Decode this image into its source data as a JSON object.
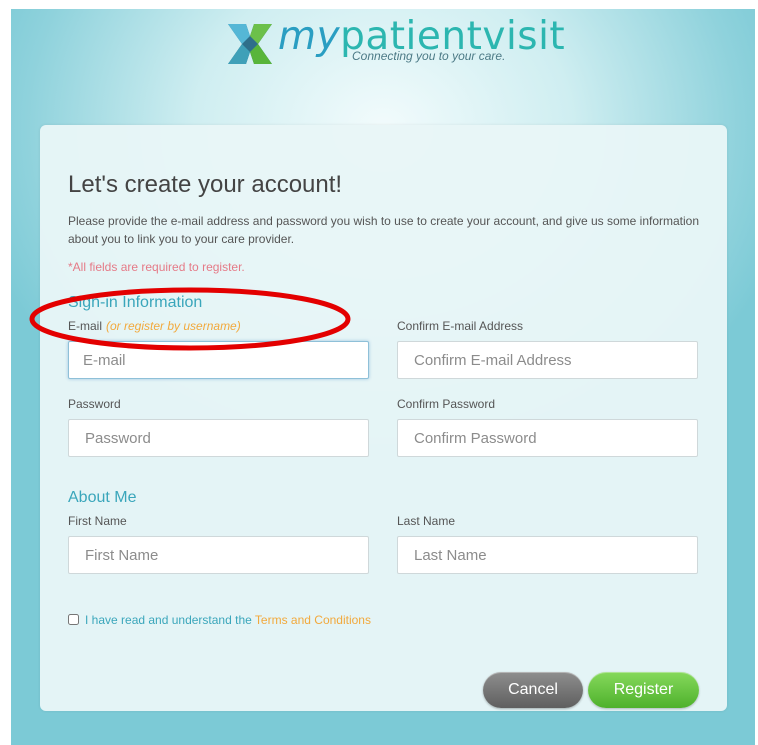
{
  "brand": {
    "word_my": "my",
    "word_rest": "patientvisit",
    "tagline": "Connecting you to your care."
  },
  "form": {
    "title": "Let's create your account!",
    "intro": "Please provide the e-mail address and password you wish to use to create your account, and give us some information about you to link you to your care provider.",
    "required_note": "*All fields are required to register.",
    "signin_heading": "Sign-in Information",
    "email": {
      "label": "E-mail",
      "hint": "(or register by username)",
      "placeholder": "E-mail",
      "value": ""
    },
    "confirm_email": {
      "label": "Confirm E-mail Address",
      "placeholder": "Confirm E-mail Address",
      "value": ""
    },
    "password": {
      "label": "Password",
      "placeholder": "Password",
      "value": ""
    },
    "confirm_password": {
      "label": "Confirm Password",
      "placeholder": "Confirm Password",
      "value": ""
    },
    "about_heading": "About Me",
    "first_name": {
      "label": "First Name",
      "placeholder": "First Name",
      "value": ""
    },
    "last_name": {
      "label": "Last Name",
      "placeholder": "Last Name",
      "value": ""
    },
    "terms": {
      "text": "I have read and understand the",
      "link": "Terms and Conditions",
      "checked": false
    },
    "cancel_label": "Cancel",
    "register_label": "Register"
  },
  "colors": {
    "accent_teal": "#3aa6bb",
    "hint_orange": "#f2a93c",
    "required_red": "#e57a87",
    "register_green": "#5cc23a",
    "annotation_red": "#e30000"
  }
}
